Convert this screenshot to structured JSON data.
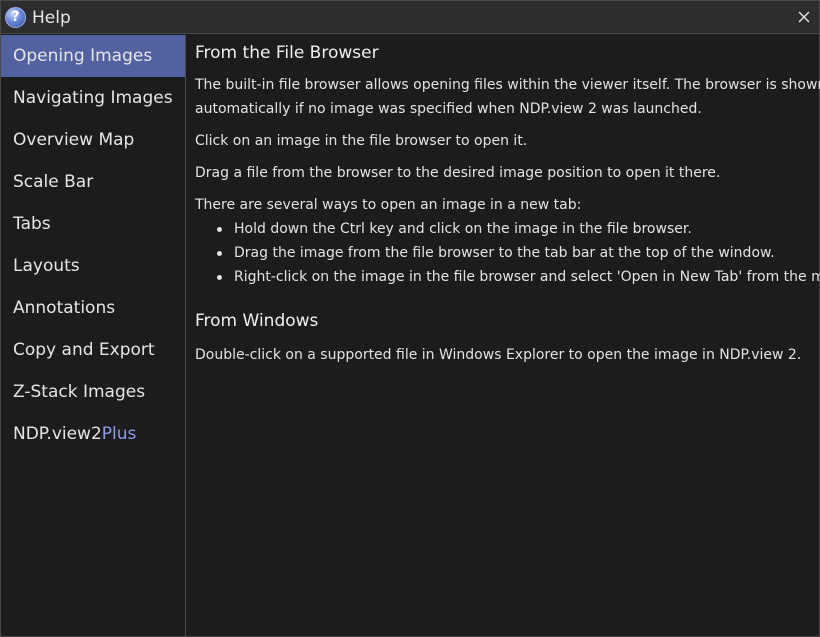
{
  "window": {
    "title": "Help",
    "icon": "help-icon",
    "close_icon": "close-icon"
  },
  "sidebar": {
    "items": [
      {
        "label": "Opening Images",
        "active": true
      },
      {
        "label": "Navigating Images"
      },
      {
        "label": "Overview Map"
      },
      {
        "label": "Scale Bar"
      },
      {
        "label": "Tabs"
      },
      {
        "label": "Layouts"
      },
      {
        "label": "Annotations"
      },
      {
        "label": "Copy and Export"
      },
      {
        "label": "Z-Stack Images"
      },
      {
        "label": "NDP.view2",
        "suffix": "Plus"
      }
    ]
  },
  "content": {
    "heading1": "From the File Browser",
    "p1_line1": "The built-in file browser allows opening files within the viewer itself. The browser is shown",
    "p1_line2": "automatically if no image was specified when NDP.view 2 was launched.",
    "p2": "Click on an image in the file browser to open it.",
    "p3": "Drag a file from the browser to the desired image position to open it there.",
    "p4": "There are several ways to open an image in a new tab:",
    "bullets": [
      "Hold down the Ctrl key and click on the image in the file browser.",
      "Drag the image from the file browser to the tab bar at the top of the window.",
      "Right-click on the image in the file browser and select 'Open in New Tab' from the menu."
    ],
    "heading2": "From Windows",
    "p5": "Double-click on a supported file in Windows Explorer to open the image in NDP.view 2."
  },
  "colors": {
    "accent": "#5261a0",
    "plus_text": "#8c9ce6",
    "background": "#1c1c1e"
  }
}
